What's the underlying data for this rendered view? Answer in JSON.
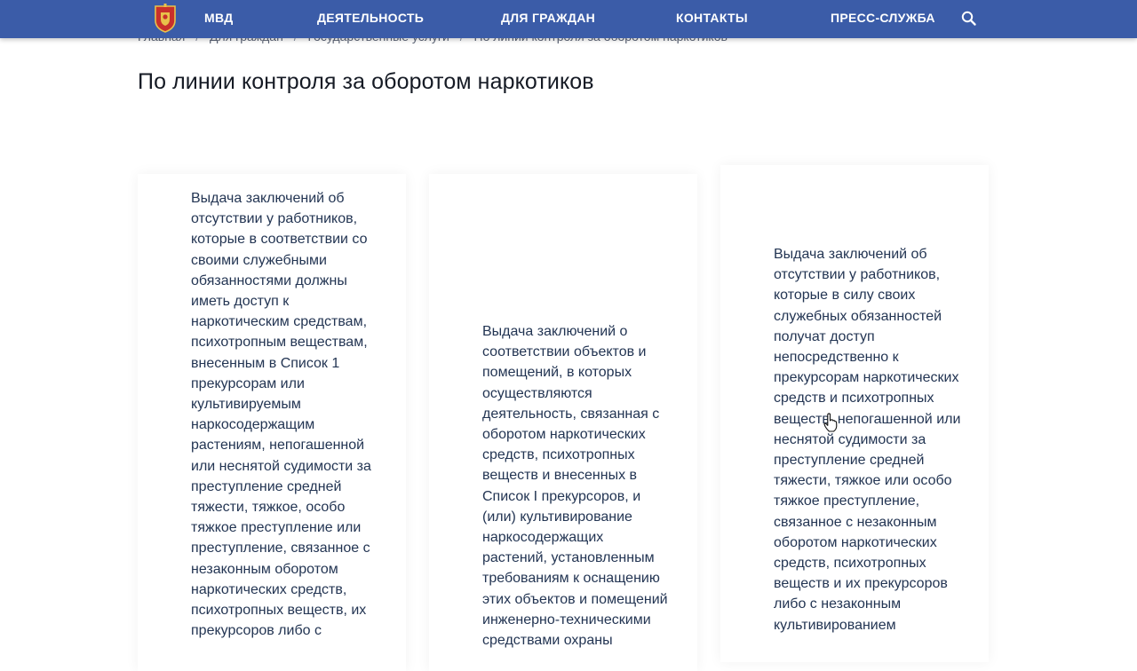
{
  "header": {
    "logo_icon": "coat-of-arms-emblem",
    "nav": [
      {
        "label": "МВД"
      },
      {
        "label": "ДЕЯТЕЛЬНОСТЬ"
      },
      {
        "label": "ДЛЯ ГРАЖДАН"
      },
      {
        "label": "КОНТАКТЫ"
      },
      {
        "label": "ПРЕСС-СЛУЖБА"
      }
    ],
    "search_icon": "search-icon",
    "background_color": "#3b5ca8"
  },
  "breadcrumb": [
    "Главная",
    "Для граждан",
    "Государственные услуги",
    "По линии контроля за оборотом наркотиков"
  ],
  "breadcrumb_separator": "/",
  "page_title": "По линии контроля за оборотом наркотиков",
  "cards": [
    {
      "text": "Выдача заключений об\nотсутствии у работников,\nкоторые в соответствии со\nсвоими служебными\nобязанностями должны\nиметь доступ к\nнаркотическим средствам,\nпсихотропным веществам,\nвнесенным в Список 1\nпрекурсорам или\nкультивируемым\nнаркосодержащим\nрастениям, непогашенной\nили неснятой судимости за\nпреступление средней\nтяжести, тяжкое, особо\nтяжкое преступление или\nпреступление, связанное с\nнезаконным оборотом\nнаркотических средств,\nпсихотропных веществ, их\nпрекурсоров либо с"
    },
    {
      "text": "Выдача заключений о\nсоответствии объектов и\nпомещений, в которых\nосуществляются\nдеятельность, связанная с\nоборотом наркотических\nсредств, психотропных\nвеществ и внесенных в\nСписок I прекурсоров, и\n(или) культивирование\nнаркосодержащих\nрастений, установленным\nтребованиям к оснащению\nэтих объектов и помещений\nинженерно-техническими\nсредствами охраны"
    },
    {
      "text": "Выдача заключений об\nотсутствии у работников,\nкоторые в силу своих\nслужебных обязанностей\nполучат доступ\nнепосредственно к\nпрекурсорам наркотических\nсредств и психотропных\nвеществ, непогашенной или\nнеснятой судимости за\nпреступление средней\nтяжести, тяжкое или особо\nтяжкое преступление,\nсвязанное с незаконным\nоборотом наркотических\nсредств, психотропных\nвеществ и их прекурсоров\nлибо с незаконным\nкультивированием"
    }
  ],
  "cursor_icon": "hand-pointer-cursor-icon"
}
